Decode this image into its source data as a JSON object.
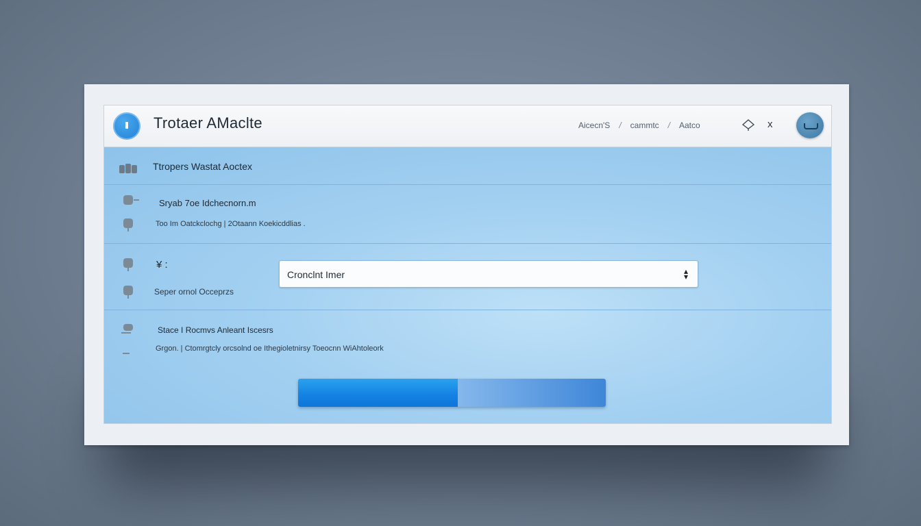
{
  "window": {
    "title": "Trotaer AMaclte",
    "breadcrumbs": [
      "Aicecn'S",
      "cammtc",
      "Aatco"
    ],
    "breadcrumb_separator": "/",
    "close_label": "x"
  },
  "section_header": "Ttropers Wastat Aoctex",
  "rows": [
    {
      "title": "Sryab 7oe Idchecnorn.m",
      "subtitle": "Too Im Oatckclochg | 2Otaann Koekicddlias ."
    },
    {
      "title": "¥ :",
      "subtitle": "Seper ornol Occeprzs"
    },
    {
      "title": "Stace I Rocmvs Anleant Iscesrs",
      "subtitle": "Grgon. | Ctomrgtcly orcsolnd oe Ithegioletnirsy Toeocnn WiAhtoleork"
    }
  ],
  "select": {
    "value": "Cronclnt Imer"
  },
  "progress": {
    "fraction": 0.52
  },
  "colors": {
    "accent": "#1381e3",
    "panel": "#a9d3f1",
    "titlebar": "#f4f6f8"
  },
  "icons": {
    "app": "app-icon",
    "cloud": "cloud-icon",
    "close": "close-icon",
    "avatar": "avatar"
  }
}
